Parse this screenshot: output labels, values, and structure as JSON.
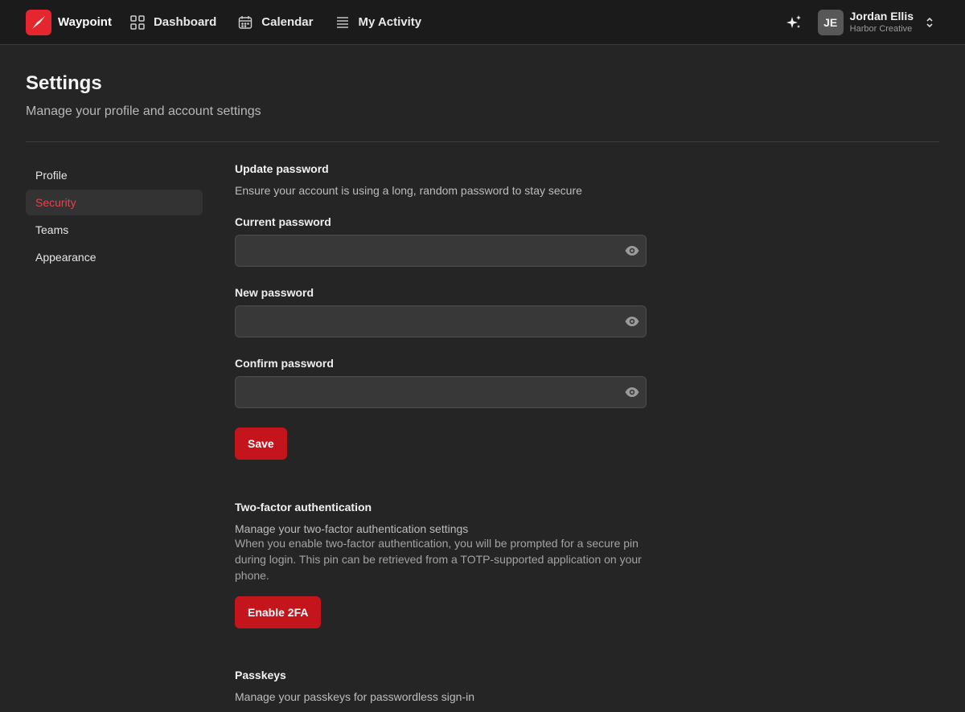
{
  "app": {
    "name": "Waypoint"
  },
  "nav": [
    {
      "label": "Dashboard",
      "icon": "grid-icon"
    },
    {
      "label": "Calendar",
      "icon": "calendar-icon"
    },
    {
      "label": "My Activity",
      "icon": "list-icon"
    }
  ],
  "user": {
    "initials": "JE",
    "name": "Jordan Ellis",
    "org": "Harbor Creative"
  },
  "header": {
    "title": "Settings",
    "subtitle": "Manage your profile and account settings"
  },
  "sidebar": {
    "items": [
      {
        "label": "Profile",
        "active": false
      },
      {
        "label": "Security",
        "active": true
      },
      {
        "label": "Teams",
        "active": false
      },
      {
        "label": "Appearance",
        "active": false
      }
    ]
  },
  "password": {
    "title": "Update password",
    "description": "Ensure your account is using a long, random password to stay secure",
    "current_label": "Current password",
    "current_value": "",
    "new_label": "New password",
    "new_value": "",
    "confirm_label": "Confirm password",
    "confirm_value": "",
    "save_label": "Save"
  },
  "twofa": {
    "title": "Two-factor authentication",
    "description": "Manage your two-factor authentication settings",
    "detail": "When you enable two-factor authentication, you will be prompted for a secure pin during login. This pin can be retrieved from a TOTP-supported application on your phone.",
    "button_label": "Enable 2FA"
  },
  "passkeys": {
    "title": "Passkeys",
    "description": "Manage your passkeys for passwordless sign-in"
  },
  "colors": {
    "accent": "#c4151d",
    "active_text": "#e5434b",
    "background": "#252525",
    "topbar": "#1b1b1b"
  }
}
